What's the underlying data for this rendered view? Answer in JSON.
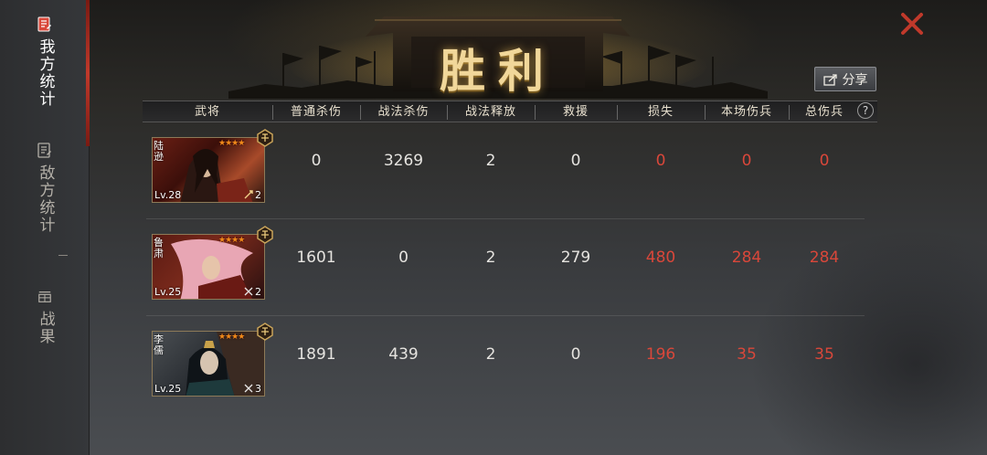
{
  "sidebar": {
    "items": [
      {
        "label": "我方统计",
        "icon": "document-icon",
        "active": true
      },
      {
        "label": "敌方统计",
        "icon": "document-icon",
        "active": false
      },
      {
        "label": "战果",
        "icon": "treasure-icon",
        "active": false
      }
    ]
  },
  "header": {
    "title": "胜利",
    "share_label": "分享",
    "close_icon": "close-icon"
  },
  "table": {
    "columns": [
      "武将",
      "普通杀伤",
      "战法杀伤",
      "战法释放",
      "救援",
      "损失",
      "本场伤兵",
      "总伤兵"
    ],
    "help_symbol": "?",
    "rows": [
      {
        "name": "陆逊",
        "level": "Lv.28",
        "stars": "★★★★",
        "count": "2",
        "normal_kill": "0",
        "tactic_kill": "3269",
        "tactic_cast": "2",
        "rescue": "0",
        "loss": "0",
        "wounded": "0",
        "total_wounded": "0"
      },
      {
        "name": "鲁肃",
        "level": "Lv.25",
        "stars": "★★★★",
        "count": "2",
        "normal_kill": "1601",
        "tactic_kill": "0",
        "tactic_cast": "2",
        "rescue": "279",
        "loss": "480",
        "wounded": "284",
        "total_wounded": "284"
      },
      {
        "name": "李儒",
        "level": "Lv.25",
        "stars": "★★★★",
        "count": "3",
        "normal_kill": "1891",
        "tactic_kill": "439",
        "tactic_cast": "2",
        "rescue": "0",
        "loss": "196",
        "wounded": "35",
        "total_wounded": "35"
      }
    ]
  },
  "colors": {
    "loss_red": "#d9473a",
    "title_gold": "#f1d79a",
    "accent_red": "#c0392b"
  }
}
